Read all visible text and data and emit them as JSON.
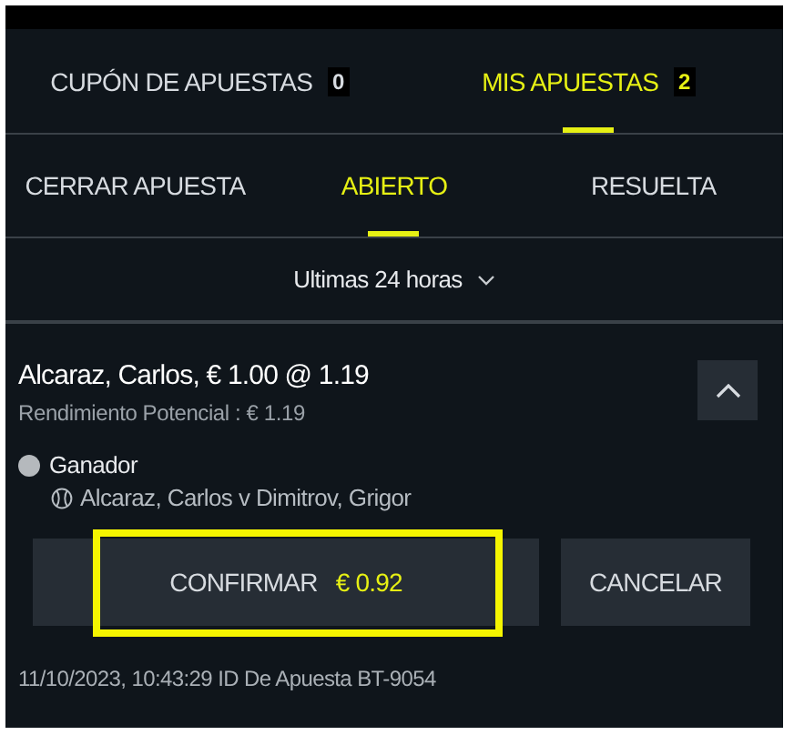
{
  "main_tabs": [
    {
      "label": "CUPÓN DE APUESTAS",
      "count": "0",
      "selected": false
    },
    {
      "label": "MIS APUESTAS",
      "count": "2",
      "selected": true
    }
  ],
  "sub_tabs": [
    {
      "label": "CERRAR APUESTA",
      "selected": false
    },
    {
      "label": "ABIERTO",
      "selected": true
    },
    {
      "label": "RESUELTA",
      "selected": false
    }
  ],
  "filter": {
    "label": "Ultimas 24 horas"
  },
  "bet": {
    "title": "Alcaraz, Carlos, € 1.00 @ 1.19",
    "potential_return": "Rendimiento Potencial : € 1.19",
    "expanded": true,
    "market": "Ganador",
    "event": "Alcaraz, Carlos v Dimitrov, Grigor",
    "confirm_button": {
      "label": "CONFIRMAR",
      "amount": "€ 0.92",
      "highlighted": true
    },
    "cancel_button": {
      "label": "CANCELAR"
    },
    "footer": "11/10/2023, 10:43:29 ID De Apuesta BT-9054"
  }
}
